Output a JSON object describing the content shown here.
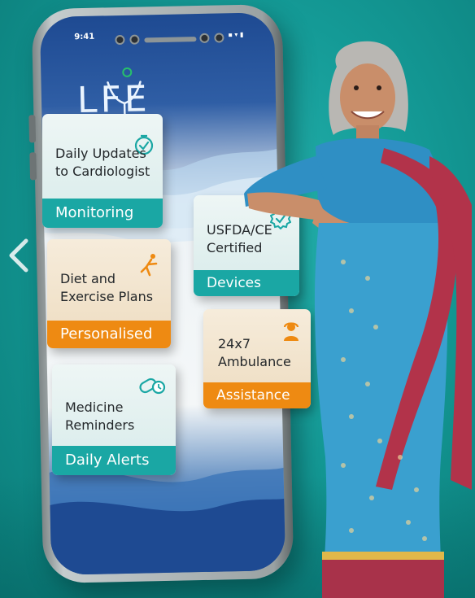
{
  "phone": {
    "status_time": "9:41",
    "status_icons": "▪ ▾ ▮"
  },
  "app": {
    "logo_text": "LFE"
  },
  "cards": [
    {
      "text_line1": "Daily Updates",
      "text_line2": "to Cardiologist",
      "tag": "Monitoring",
      "icon": "clock-check-icon"
    },
    {
      "text_line1": "USFDA/CE",
      "text_line2": "Certified",
      "tag": "Devices",
      "icon": "verified-badge-icon"
    },
    {
      "text_line1": "Diet and",
      "text_line2": "Exercise Plans",
      "tag": "Personalised",
      "icon": "yoga-pose-icon"
    },
    {
      "text_line1": "24x7",
      "text_line2": "Ambulance",
      "tag": "Assistance",
      "icon": "support-agent-icon"
    },
    {
      "text_line1": "Medicine",
      "text_line2": "Reminders",
      "tag": "Daily Alerts",
      "icon": "pill-clock-icon"
    }
  ],
  "colors": {
    "teal_accent": "#1aa7a4",
    "orange_accent": "#ee8a12",
    "background": "#149a96"
  }
}
